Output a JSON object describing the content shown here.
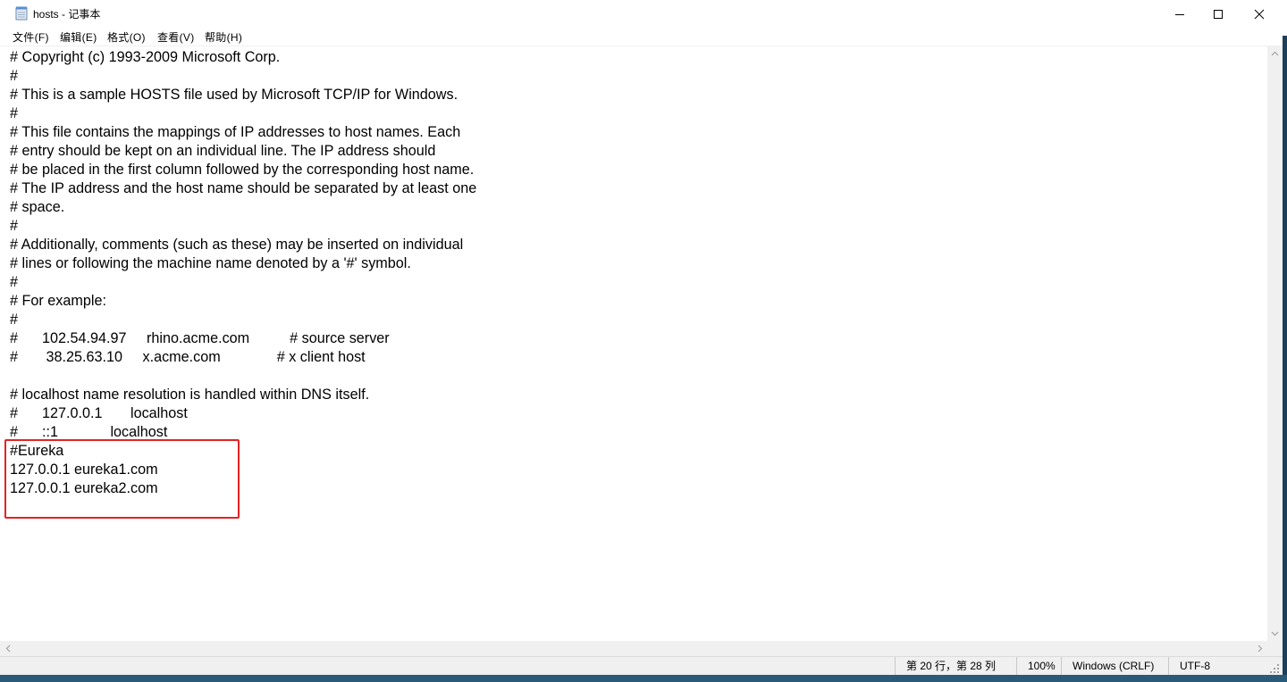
{
  "window": {
    "title": "hosts - 记事本",
    "icon": "notepad-icon"
  },
  "menu": [
    {
      "label": "文件(F)"
    },
    {
      "label": "编辑(E)"
    },
    {
      "label": "格式(O)"
    },
    {
      "label": "查看(V)"
    },
    {
      "label": "帮助(H)"
    }
  ],
  "document": {
    "lines": [
      "# Copyright (c) 1993-2009 Microsoft Corp.",
      "#",
      "# This is a sample HOSTS file used by Microsoft TCP/IP for Windows.",
      "#",
      "# This file contains the mappings of IP addresses to host names. Each",
      "# entry should be kept on an individual line. The IP address should",
      "# be placed in the first column followed by the corresponding host name.",
      "# The IP address and the host name should be separated by at least one",
      "# space.",
      "#",
      "# Additionally, comments (such as these) may be inserted on individual",
      "# lines or following the machine name denoted by a '#' symbol.",
      "#",
      "# For example:",
      "#",
      "#      102.54.94.97     rhino.acme.com          # source server",
      "#       38.25.63.10     x.acme.com              # x client host",
      "",
      "# localhost name resolution is handled within DNS itself.",
      "#\t127.0.0.1       localhost",
      "#\t::1             localhost",
      "#Eureka",
      "127.0.0.1 eureka1.com",
      "127.0.0.1 eureka2.com"
    ]
  },
  "status": {
    "position": "第 20 行，第 28 列",
    "zoom": "100%",
    "line_ending": "Windows (CRLF)",
    "encoding": "UTF-8"
  },
  "colors": {
    "highlight_border": "#e52222"
  }
}
